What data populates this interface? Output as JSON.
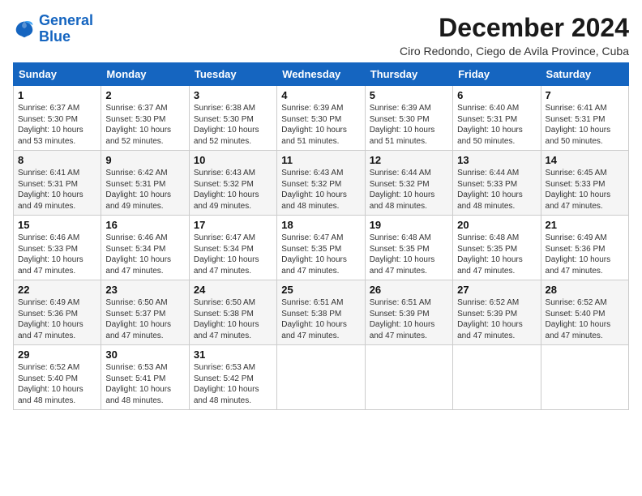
{
  "logo": {
    "line1": "General",
    "line2": "Blue"
  },
  "title": "December 2024",
  "location": "Ciro Redondo, Ciego de Avila Province, Cuba",
  "weekdays": [
    "Sunday",
    "Monday",
    "Tuesday",
    "Wednesday",
    "Thursday",
    "Friday",
    "Saturday"
  ],
  "weeks": [
    [
      {
        "day": "1",
        "info": "Sunrise: 6:37 AM\nSunset: 5:30 PM\nDaylight: 10 hours\nand 53 minutes."
      },
      {
        "day": "2",
        "info": "Sunrise: 6:37 AM\nSunset: 5:30 PM\nDaylight: 10 hours\nand 52 minutes."
      },
      {
        "day": "3",
        "info": "Sunrise: 6:38 AM\nSunset: 5:30 PM\nDaylight: 10 hours\nand 52 minutes."
      },
      {
        "day": "4",
        "info": "Sunrise: 6:39 AM\nSunset: 5:30 PM\nDaylight: 10 hours\nand 51 minutes."
      },
      {
        "day": "5",
        "info": "Sunrise: 6:39 AM\nSunset: 5:30 PM\nDaylight: 10 hours\nand 51 minutes."
      },
      {
        "day": "6",
        "info": "Sunrise: 6:40 AM\nSunset: 5:31 PM\nDaylight: 10 hours\nand 50 minutes."
      },
      {
        "day": "7",
        "info": "Sunrise: 6:41 AM\nSunset: 5:31 PM\nDaylight: 10 hours\nand 50 minutes."
      }
    ],
    [
      {
        "day": "8",
        "info": "Sunrise: 6:41 AM\nSunset: 5:31 PM\nDaylight: 10 hours\nand 49 minutes."
      },
      {
        "day": "9",
        "info": "Sunrise: 6:42 AM\nSunset: 5:31 PM\nDaylight: 10 hours\nand 49 minutes."
      },
      {
        "day": "10",
        "info": "Sunrise: 6:43 AM\nSunset: 5:32 PM\nDaylight: 10 hours\nand 49 minutes."
      },
      {
        "day": "11",
        "info": "Sunrise: 6:43 AM\nSunset: 5:32 PM\nDaylight: 10 hours\nand 48 minutes."
      },
      {
        "day": "12",
        "info": "Sunrise: 6:44 AM\nSunset: 5:32 PM\nDaylight: 10 hours\nand 48 minutes."
      },
      {
        "day": "13",
        "info": "Sunrise: 6:44 AM\nSunset: 5:33 PM\nDaylight: 10 hours\nand 48 minutes."
      },
      {
        "day": "14",
        "info": "Sunrise: 6:45 AM\nSunset: 5:33 PM\nDaylight: 10 hours\nand 47 minutes."
      }
    ],
    [
      {
        "day": "15",
        "info": "Sunrise: 6:46 AM\nSunset: 5:33 PM\nDaylight: 10 hours\nand 47 minutes."
      },
      {
        "day": "16",
        "info": "Sunrise: 6:46 AM\nSunset: 5:34 PM\nDaylight: 10 hours\nand 47 minutes."
      },
      {
        "day": "17",
        "info": "Sunrise: 6:47 AM\nSunset: 5:34 PM\nDaylight: 10 hours\nand 47 minutes."
      },
      {
        "day": "18",
        "info": "Sunrise: 6:47 AM\nSunset: 5:35 PM\nDaylight: 10 hours\nand 47 minutes."
      },
      {
        "day": "19",
        "info": "Sunrise: 6:48 AM\nSunset: 5:35 PM\nDaylight: 10 hours\nand 47 minutes."
      },
      {
        "day": "20",
        "info": "Sunrise: 6:48 AM\nSunset: 5:35 PM\nDaylight: 10 hours\nand 47 minutes."
      },
      {
        "day": "21",
        "info": "Sunrise: 6:49 AM\nSunset: 5:36 PM\nDaylight: 10 hours\nand 47 minutes."
      }
    ],
    [
      {
        "day": "22",
        "info": "Sunrise: 6:49 AM\nSunset: 5:36 PM\nDaylight: 10 hours\nand 47 minutes."
      },
      {
        "day": "23",
        "info": "Sunrise: 6:50 AM\nSunset: 5:37 PM\nDaylight: 10 hours\nand 47 minutes."
      },
      {
        "day": "24",
        "info": "Sunrise: 6:50 AM\nSunset: 5:38 PM\nDaylight: 10 hours\nand 47 minutes."
      },
      {
        "day": "25",
        "info": "Sunrise: 6:51 AM\nSunset: 5:38 PM\nDaylight: 10 hours\nand 47 minutes."
      },
      {
        "day": "26",
        "info": "Sunrise: 6:51 AM\nSunset: 5:39 PM\nDaylight: 10 hours\nand 47 minutes."
      },
      {
        "day": "27",
        "info": "Sunrise: 6:52 AM\nSunset: 5:39 PM\nDaylight: 10 hours\nand 47 minutes."
      },
      {
        "day": "28",
        "info": "Sunrise: 6:52 AM\nSunset: 5:40 PM\nDaylight: 10 hours\nand 47 minutes."
      }
    ],
    [
      {
        "day": "29",
        "info": "Sunrise: 6:52 AM\nSunset: 5:40 PM\nDaylight: 10 hours\nand 48 minutes."
      },
      {
        "day": "30",
        "info": "Sunrise: 6:53 AM\nSunset: 5:41 PM\nDaylight: 10 hours\nand 48 minutes."
      },
      {
        "day": "31",
        "info": "Sunrise: 6:53 AM\nSunset: 5:42 PM\nDaylight: 10 hours\nand 48 minutes."
      },
      null,
      null,
      null,
      null
    ]
  ]
}
